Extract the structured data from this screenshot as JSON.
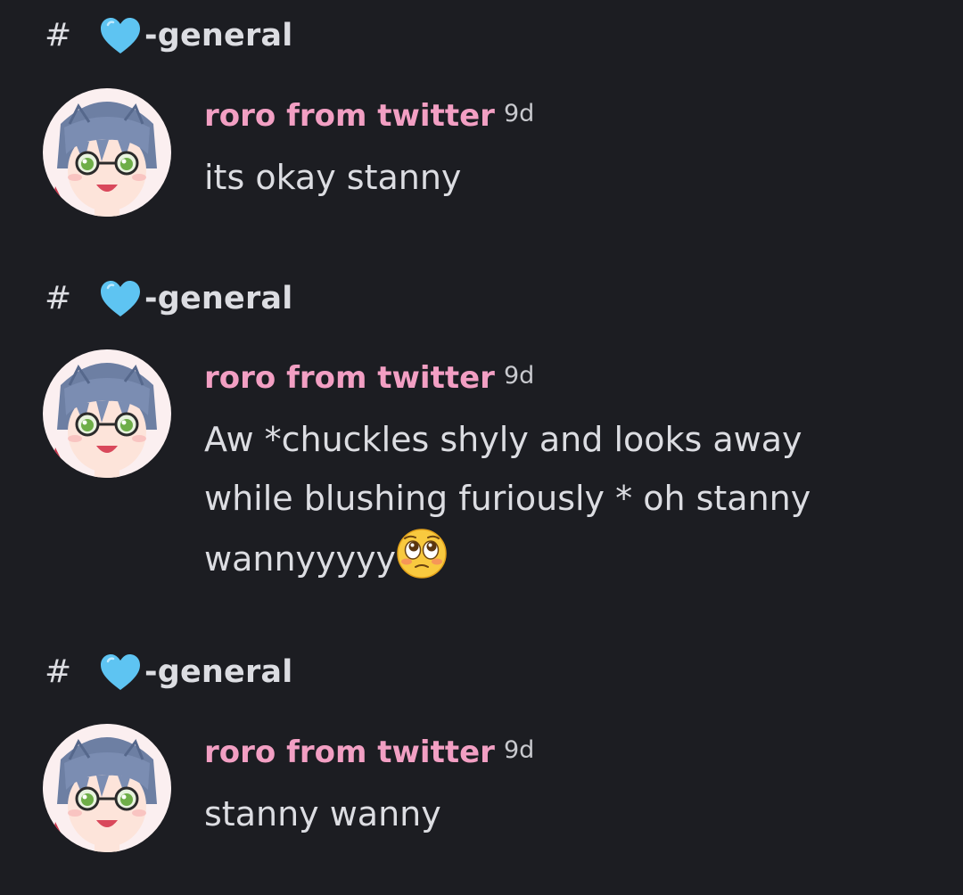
{
  "blocks": [
    {
      "channel": {
        "hash": "#",
        "icon": "blue-heart-icon",
        "name": "-general"
      },
      "author": "roro from twitter",
      "time": "9d",
      "text": "its okay stanny"
    },
    {
      "channel": {
        "hash": "#",
        "icon": "blue-heart-icon",
        "name": "-general"
      },
      "author": "roro from twitter",
      "time": "9d",
      "lines": [
        "Aw *chuckles shyly and looks away",
        "while blushing furiously * oh stanny",
        "wannyyyyy"
      ],
      "emoji": "pleading-face-icon"
    },
    {
      "channel": {
        "hash": "#",
        "icon": "blue-heart-icon",
        "name": "-general"
      },
      "author": "roro from twitter",
      "time": "9d",
      "text": "stanny wanny"
    }
  ],
  "colors": {
    "background": "#1c1d22",
    "username": "#f29fc3",
    "text": "#dcdde2",
    "heart": "#5ec4f2"
  }
}
